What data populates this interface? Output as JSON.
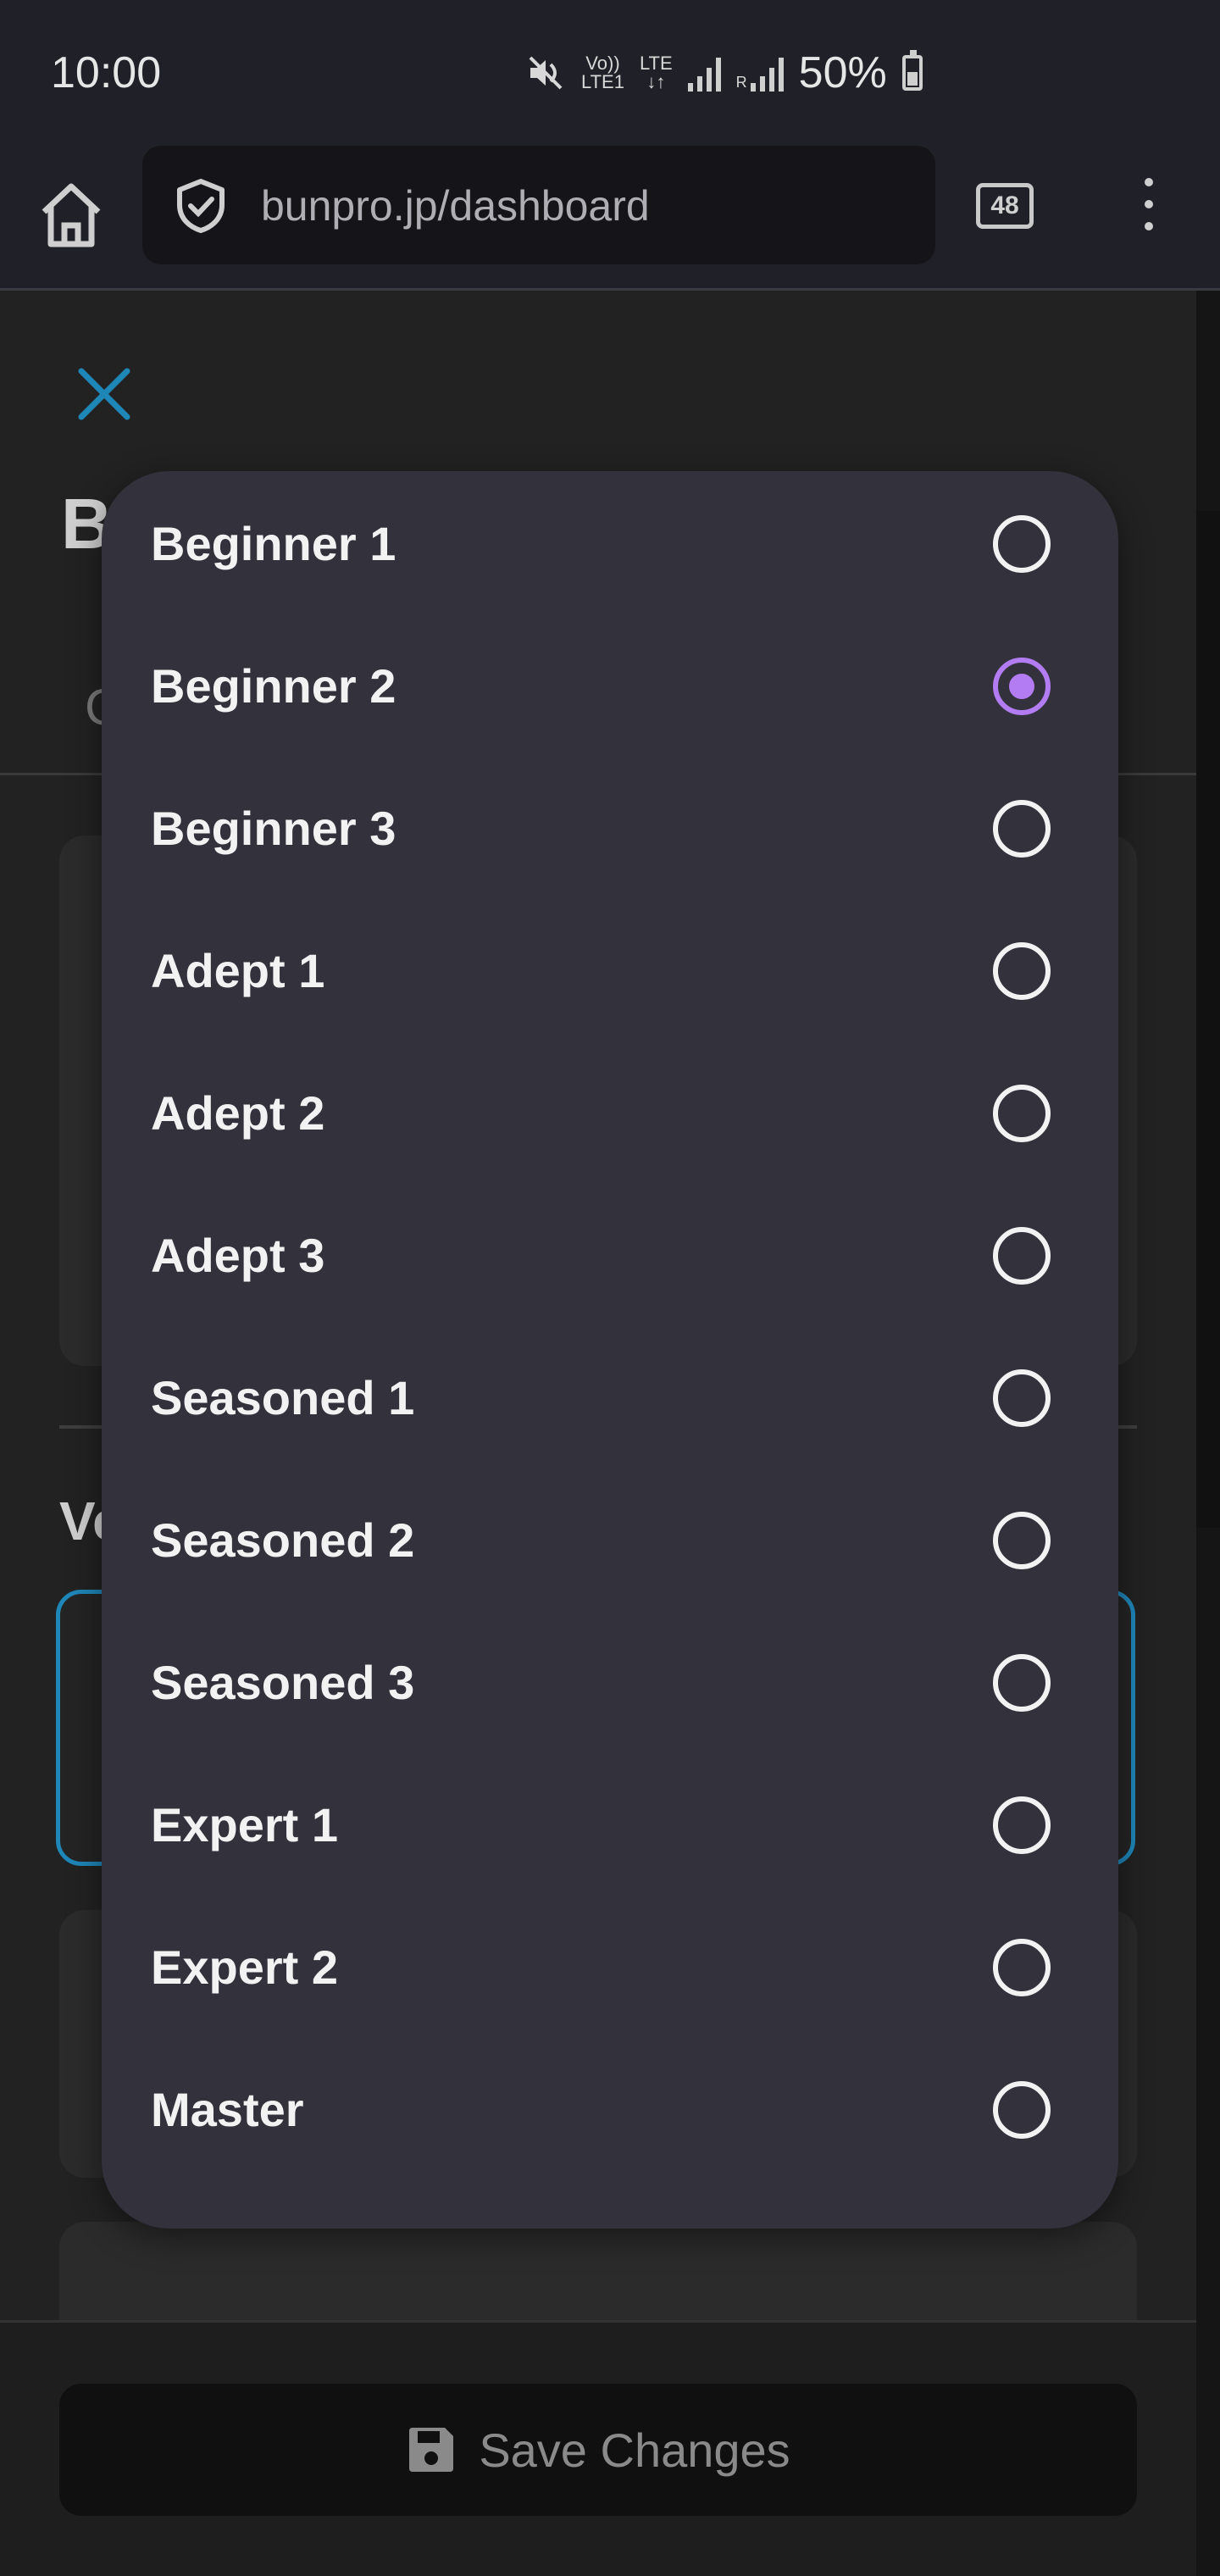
{
  "status_bar": {
    "time": "10:00",
    "network_top": "Vo))",
    "network_bottom": "LTE1",
    "lte_label": "LTE",
    "roaming_label": "R",
    "battery_percent": "50%",
    "icons": [
      "mute-icon",
      "volte-icon",
      "lte-icon",
      "signal-icon",
      "signal-roaming-icon",
      "battery-charging-icon"
    ]
  },
  "browser": {
    "url": "bunpro.jp/dashboard",
    "tab_count": "48",
    "icons": [
      "home-icon",
      "shield-check-icon",
      "tabs-icon",
      "more-vert-icon"
    ]
  },
  "page": {
    "title_partial": "B",
    "tab_partial": "C",
    "section_label_partial": "Ve",
    "accent_color": "#1f86b8",
    "save_button_label": "Save Changes"
  },
  "dropdown": {
    "accent_color": "#b47cf2",
    "selected_value": "Beginner 2",
    "options": [
      {
        "label": "Beginner 1",
        "selected": false
      },
      {
        "label": "Beginner 2",
        "selected": true
      },
      {
        "label": "Beginner 3",
        "selected": false
      },
      {
        "label": "Adept 1",
        "selected": false
      },
      {
        "label": "Adept 2",
        "selected": false
      },
      {
        "label": "Adept 3",
        "selected": false
      },
      {
        "label": "Seasoned 1",
        "selected": false
      },
      {
        "label": "Seasoned 2",
        "selected": false
      },
      {
        "label": "Seasoned 3",
        "selected": false
      },
      {
        "label": "Expert 1",
        "selected": false
      },
      {
        "label": "Expert 2",
        "selected": false
      },
      {
        "label": "Master",
        "selected": false
      }
    ]
  }
}
